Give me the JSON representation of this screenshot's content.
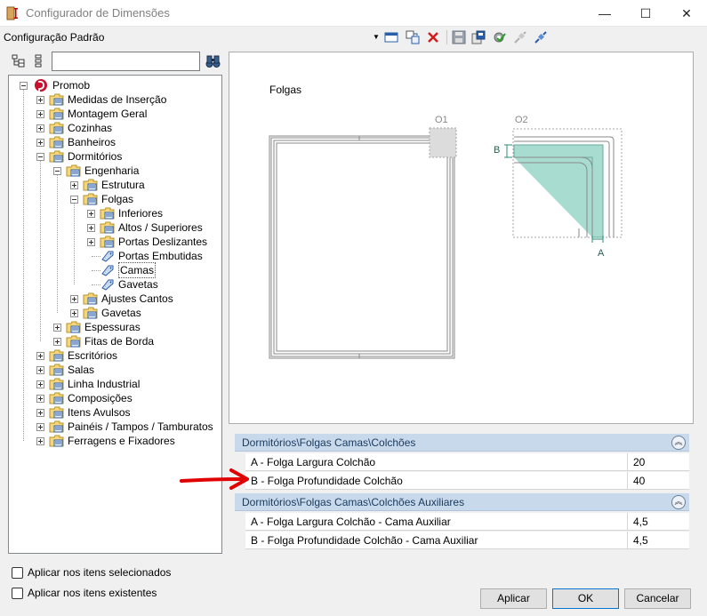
{
  "window": {
    "title": "Configurador de Dimensões",
    "controls": {
      "minimize": "—",
      "maximize": "☐",
      "close": "✕"
    }
  },
  "toolbar": {
    "configuration": "Configuração Padrão",
    "icons": [
      "dropdown-arrow-icon",
      "window-icon",
      "add-config-icon",
      "delete-icon",
      "save-icon",
      "export-icon",
      "settings-icon",
      "connect-icon",
      "disconnect-icon"
    ]
  },
  "search": {
    "value": "",
    "placeholder": ""
  },
  "tree": {
    "root": "Promob",
    "items": [
      {
        "label": "Medidas de Inserção",
        "level": 1,
        "expander": "plus",
        "kind": "folder"
      },
      {
        "label": "Montagem Geral",
        "level": 1,
        "expander": "plus",
        "kind": "folder"
      },
      {
        "label": "Cozinhas",
        "level": 1,
        "expander": "plus",
        "kind": "folder"
      },
      {
        "label": "Banheiros",
        "level": 1,
        "expander": "plus",
        "kind": "folder"
      },
      {
        "label": "Dormitórios",
        "level": 1,
        "expander": "minus",
        "kind": "folder"
      },
      {
        "label": "Engenharia",
        "level": 2,
        "expander": "minus",
        "kind": "folder"
      },
      {
        "label": "Estrutura",
        "level": 3,
        "expander": "plus",
        "kind": "folder"
      },
      {
        "label": "Folgas",
        "level": 3,
        "expander": "minus",
        "kind": "folder"
      },
      {
        "label": "Inferiores",
        "level": 4,
        "expander": "plus",
        "kind": "folder"
      },
      {
        "label": "Altos / Superiores",
        "level": 4,
        "expander": "plus",
        "kind": "folder"
      },
      {
        "label": "Portas Deslizantes",
        "level": 4,
        "expander": "plus",
        "kind": "folder"
      },
      {
        "label": "Portas Embutidas",
        "level": 4,
        "expander": "none",
        "kind": "leaf"
      },
      {
        "label": "Camas",
        "level": 4,
        "expander": "none",
        "kind": "leaf",
        "selected": true
      },
      {
        "label": "Gavetas",
        "level": 4,
        "expander": "none",
        "kind": "leaf"
      },
      {
        "label": "Ajustes Cantos",
        "level": 3,
        "expander": "plus",
        "kind": "folder"
      },
      {
        "label": "Gavetas",
        "level": 3,
        "expander": "plus",
        "kind": "folder"
      },
      {
        "label": "Espessuras",
        "level": 2,
        "expander": "plus",
        "kind": "folder"
      },
      {
        "label": "Fitas de Borda",
        "level": 2,
        "expander": "plus",
        "kind": "folder"
      },
      {
        "label": "Escritórios",
        "level": 1,
        "expander": "plus",
        "kind": "folder"
      },
      {
        "label": "Salas",
        "level": 1,
        "expander": "plus",
        "kind": "folder"
      },
      {
        "label": "Linha Industrial",
        "level": 1,
        "expander": "plus",
        "kind": "folder"
      },
      {
        "label": "Composições",
        "level": 1,
        "expander": "plus",
        "kind": "folder"
      },
      {
        "label": "Itens Avulsos",
        "level": 1,
        "expander": "plus",
        "kind": "folder"
      },
      {
        "label": "Painéis / Tampos / Tamburatos",
        "level": 1,
        "expander": "plus",
        "kind": "folder"
      },
      {
        "label": "Ferragens e Fixadores",
        "level": 1,
        "expander": "plus",
        "kind": "folder"
      }
    ]
  },
  "preview": {
    "title": "Folgas",
    "detail1_label": "O1",
    "detail2_label": "O2",
    "dim_b": "B",
    "dim_a": "A"
  },
  "sections": [
    {
      "title": "Dormitórios\\Folgas Camas\\Colchões",
      "rows": [
        {
          "name": "A - Folga Largura Colchão",
          "value": "20"
        },
        {
          "name": "B - Folga Profundidade Colchão",
          "value": "40"
        }
      ]
    },
    {
      "title": "Dormitórios\\Folgas Camas\\Colchões Auxiliares",
      "rows": [
        {
          "name": "A - Folga Largura Colchão - Cama Auxiliar",
          "value": "4,5"
        },
        {
          "name": "B - Folga Profundidade Colchão - Cama Auxiliar",
          "value": "4,5"
        }
      ]
    }
  ],
  "options": {
    "apply_selected": "Aplicar nos itens selecionados",
    "apply_existing": "Aplicar nos itens existentes"
  },
  "buttons": {
    "apply": "Aplicar",
    "ok": "OK",
    "cancel": "Cancelar"
  },
  "colors": {
    "accent": "#c8d9ec",
    "folder": "#f5d77a",
    "annotation_arrow": "#e00000",
    "teal_fill": "#a8dcd1"
  }
}
